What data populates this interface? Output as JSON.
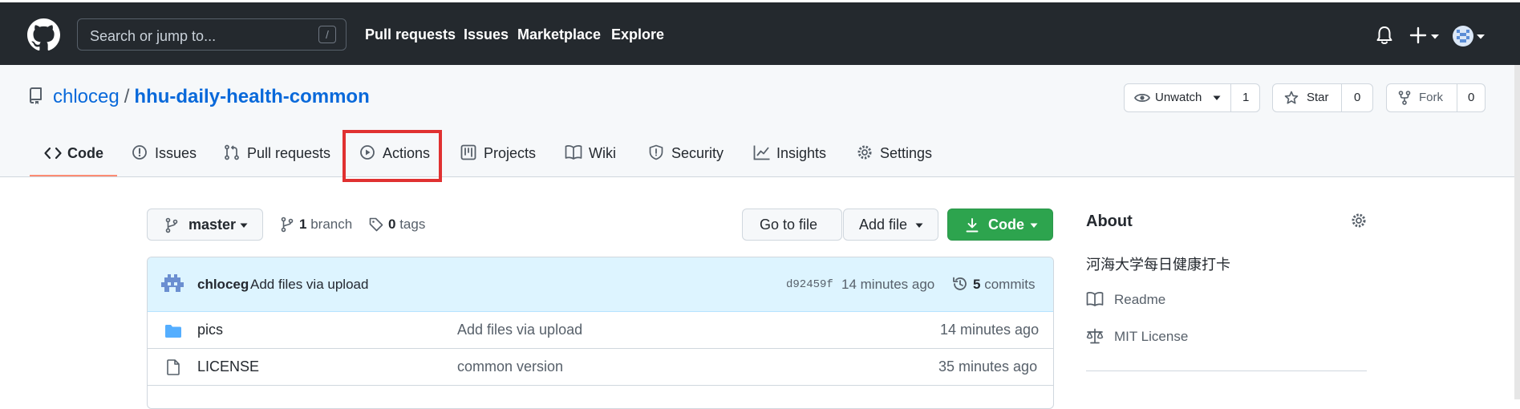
{
  "header": {
    "search_placeholder": "Search or jump to...",
    "search_shortcut": "/",
    "nav": [
      "Pull requests",
      "Issues",
      "Marketplace",
      "Explore"
    ]
  },
  "repo": {
    "owner": "chloceg",
    "separator": "/",
    "name": "hhu-daily-health-common",
    "watch_label": "Unwatch",
    "watch_count": "1",
    "star_label": "Star",
    "star_count": "0",
    "fork_label": "Fork",
    "fork_count": "0",
    "tabs": [
      "Code",
      "Issues",
      "Pull requests",
      "Actions",
      "Projects",
      "Wiki",
      "Security",
      "Insights",
      "Settings"
    ]
  },
  "toolbar": {
    "branch_name": "master",
    "branch_count": "1",
    "branch_label": "branch",
    "tag_count": "0",
    "tag_label": "tags",
    "go_to_file": "Go to file",
    "add_file": "Add file",
    "code": "Code"
  },
  "commit": {
    "author": "chloceg",
    "message": "Add files via upload",
    "sha": "d92459f",
    "time": "14 minutes ago",
    "count": "5",
    "count_label": "commits"
  },
  "files": [
    {
      "name": "pics",
      "type": "folder",
      "message": "Add files via upload",
      "time": "14 minutes ago"
    },
    {
      "name": "LICENSE",
      "type": "file",
      "message": "common version",
      "time": "35 minutes ago"
    }
  ],
  "about": {
    "title": "About",
    "description": "河海大学每日健康打卡",
    "readme": "Readme",
    "license": "MIT License"
  },
  "colors": {
    "header_bg": "#24292e",
    "link_blue": "#0969da",
    "green": "#2da44e",
    "highlight_red": "#e03131",
    "tab_underline": "#fd8c73"
  }
}
